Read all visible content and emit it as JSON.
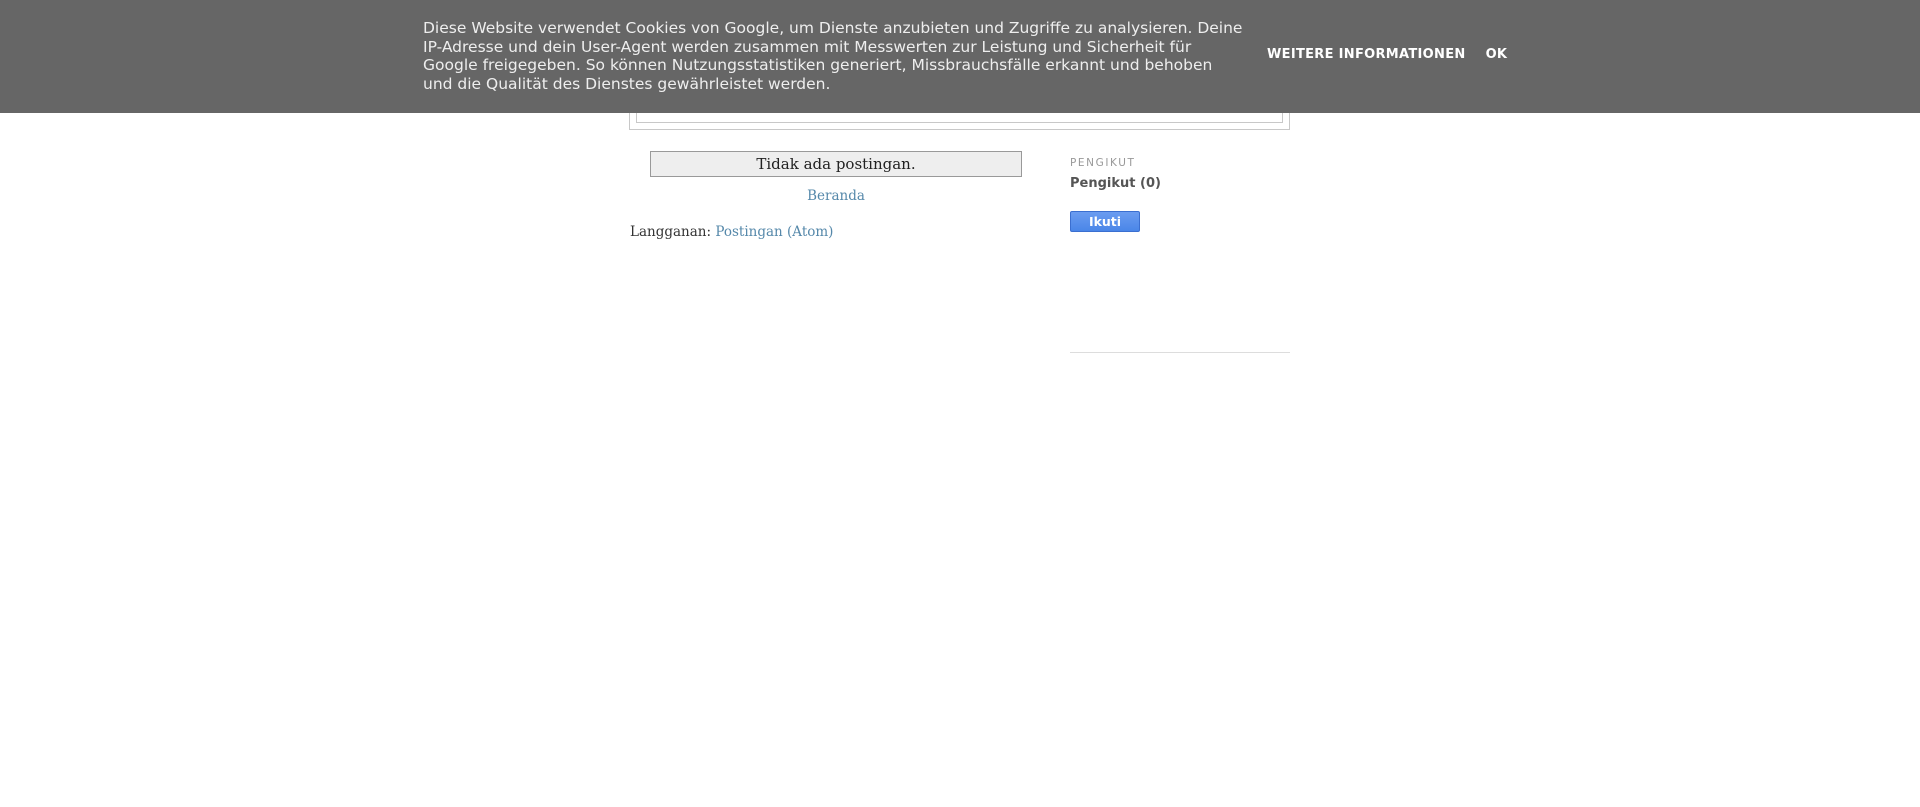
{
  "cookie_bar": {
    "message": "Diese Website verwendet Cookies von Google, um Dienste anzubieten und Zugriffe zu analysieren. Deine IP-Adresse und dein User-Agent werden zusammen mit Messwerten zur Leistung und Sicherheit für Google freigegeben. So können Nutzungsstatistiken generiert, Missbrauchsfälle erkannt und behoben und die Qualität des Dienstes gewährleistet werden.",
    "more_info_label": "WEITERE INFORMATIONEN",
    "ok_label": "OK"
  },
  "main": {
    "no_posts_message": "Tidak ada postingan.",
    "home_link": "Beranda",
    "feed_prefix": "Langganan:",
    "feed_link": "Postingan (Atom)"
  },
  "sidebar": {
    "followers_widget_title": "PENGIKUT",
    "followers_count": "Pengikut (0)",
    "follow_button": "Ikuti"
  }
}
